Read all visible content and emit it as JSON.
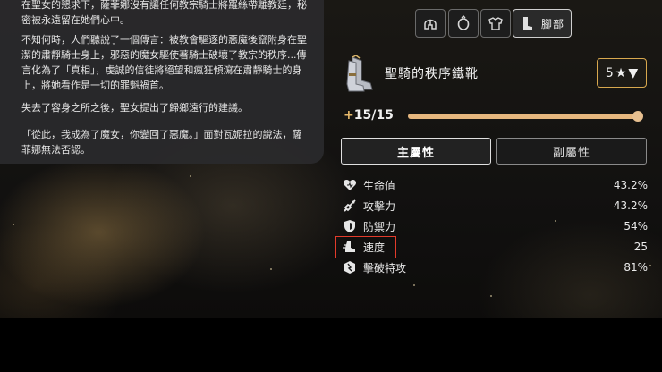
{
  "story": {
    "paragraphs": [
      "在聖女的懇求下，薩菲娜沒有讓任何教宗騎士將羅絲帶離教廷，秘密被永遠留在她們心中。",
      "不知何時，人們聽說了一個傳言：被教會驅逐的惡魔後竄附身在聖潔的肅靜騎士身上，邪惡的魔女驅使著騎士破壞了教宗的秩序...傳言化為了「真相」，虔誠的信徒將絕望和瘋狂傾瀉在肅靜騎士的身上，將她看作是一切的罪魁禍首。",
      "失去了容身之所之後，聖女提出了歸鄉遠行的建議。",
      "「從此，我成為了魔女，你變回了惡魔。」面對瓦妮拉的說法，薩菲娜無法否認。"
    ]
  },
  "slots": {
    "head_icon": "helmet-icon",
    "ring_icon": "ring-icon",
    "armor_icon": "armor-icon",
    "feet_icon": "boots-icon",
    "feet_label": "腳部"
  },
  "item": {
    "icon": "boots-icon",
    "name": "聖騎的秩序鐵靴",
    "star_value": "5",
    "star_symbol": "★",
    "dropdown_symbol": "▼"
  },
  "level": {
    "plus": "+",
    "text": "15/15",
    "current": 15,
    "max": 15
  },
  "tabs": {
    "main": "主屬性",
    "sub": "副屬性"
  },
  "stats": [
    {
      "icon": "heart-icon",
      "name": "生命值",
      "value": "43.2%"
    },
    {
      "icon": "sword-icon",
      "name": "攻擊力",
      "value": "43.2%"
    },
    {
      "icon": "shield-icon",
      "name": "防禦力",
      "value": "54%"
    },
    {
      "icon": "boot-speed-icon",
      "name": "速度",
      "value": "25"
    },
    {
      "icon": "break-icon",
      "name": "擊破特攻",
      "value": "81%"
    }
  ],
  "colors": {
    "accent_gold": "#d8a84e",
    "slider_fill": "#e6b77e",
    "highlight_red": "#e23b2b"
  }
}
